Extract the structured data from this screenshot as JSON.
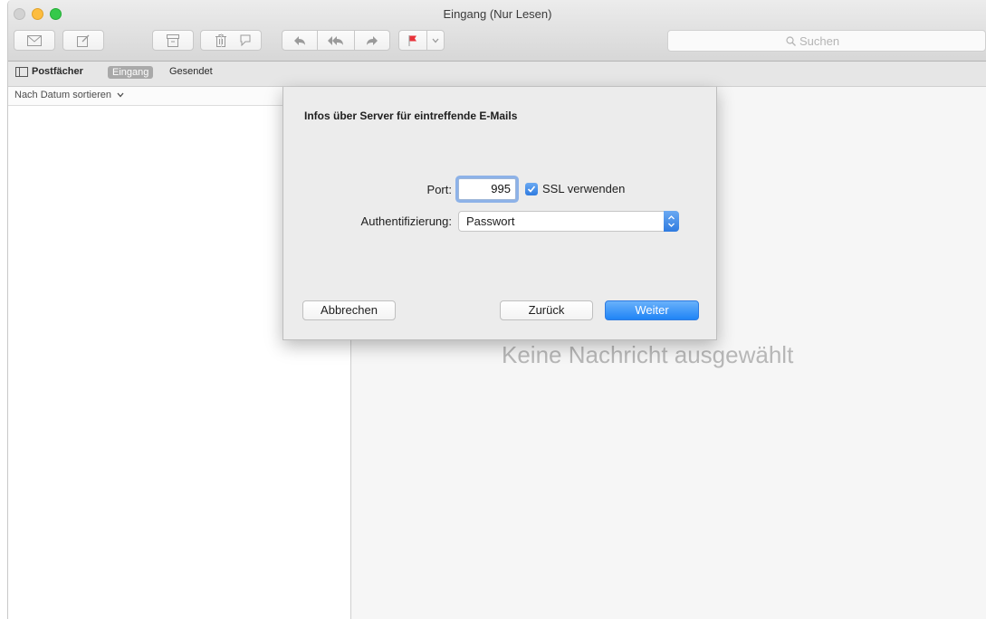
{
  "window": {
    "title": "Eingang (Nur Lesen)"
  },
  "toolbar": {
    "icons": [
      "get-mail-icon",
      "compose-icon",
      "archive-icon",
      "trash-icon",
      "junk-icon",
      "reply-icon",
      "reply-all-icon",
      "forward-icon",
      "flag-icon",
      "chevron-down-icon"
    ],
    "search_placeholder": "Suchen"
  },
  "favorites": {
    "mailboxes_label": "Postfächer",
    "inbox_label": "Eingang",
    "sent_label": "Gesendet"
  },
  "sidebar": {
    "sort_label": "Nach Datum sortieren"
  },
  "content": {
    "empty_message": "Keine Nachricht ausgewählt"
  },
  "dialog": {
    "title": "Infos über Server für eintreffende E-Mails",
    "port_label": "Port:",
    "port_value": "995",
    "ssl_label": "SSL verwenden",
    "ssl_checked": true,
    "auth_label": "Authentifizierung:",
    "auth_value": "Passwort",
    "cancel_label": "Abbrechen",
    "back_label": "Zurück",
    "next_label": "Weiter"
  },
  "colors": {
    "accent": "#2f7be0",
    "flag": "#e8333a"
  }
}
